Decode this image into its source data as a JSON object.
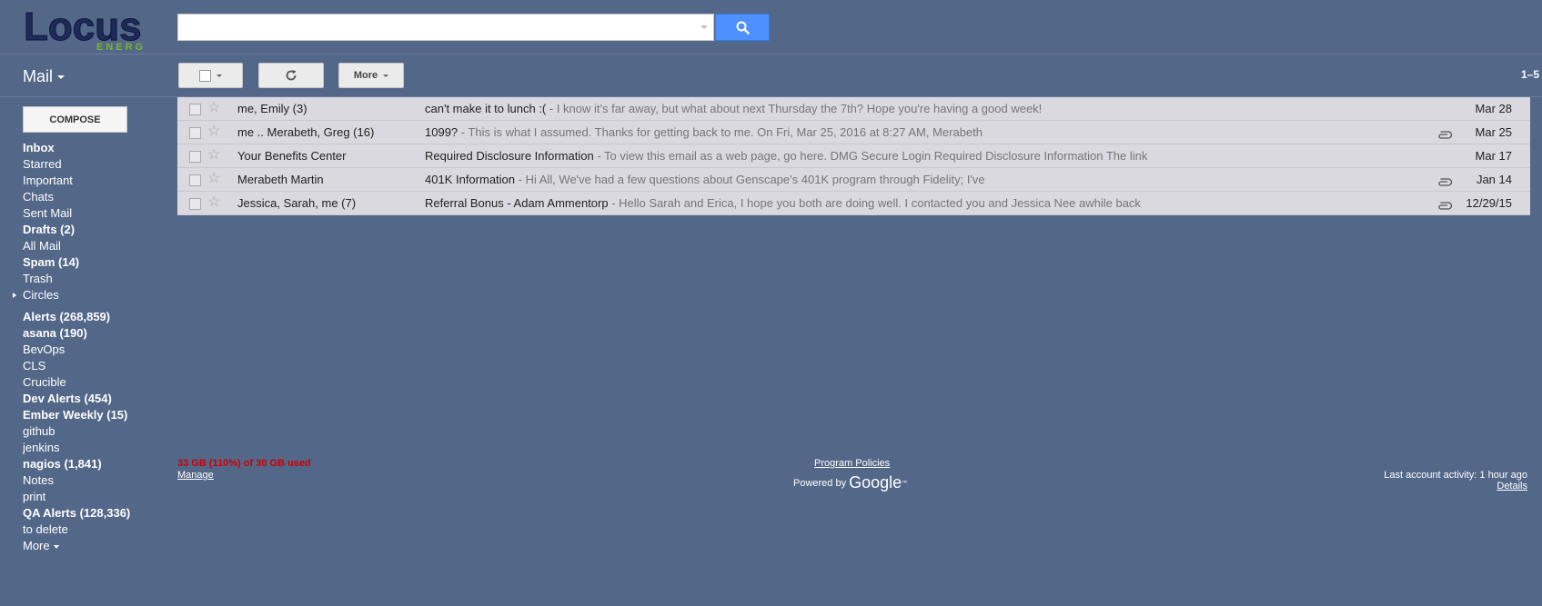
{
  "logo": {
    "word": "Locus",
    "sub": "ENERGY"
  },
  "search": {
    "placeholder": ""
  },
  "toolbar": {
    "more_label": "More",
    "range": "1–5"
  },
  "mail_title": "Mail",
  "compose_label": "COMPOSE",
  "sidebar": {
    "items": [
      {
        "label": "Inbox",
        "bold": true
      },
      {
        "label": "Starred",
        "bold": false
      },
      {
        "label": "Important",
        "bold": false
      },
      {
        "label": "Chats",
        "bold": false
      },
      {
        "label": "Sent Mail",
        "bold": false
      },
      {
        "label": "Drafts (2)",
        "bold": true
      },
      {
        "label": "All Mail",
        "bold": false
      },
      {
        "label": "Spam (14)",
        "bold": true
      },
      {
        "label": "Trash",
        "bold": false
      },
      {
        "label": "Circles",
        "bold": false
      }
    ],
    "labels": [
      {
        "label": "Alerts (268,859)",
        "bold": true
      },
      {
        "label": "asana (190)",
        "bold": true
      },
      {
        "label": "BevOps",
        "bold": false
      },
      {
        "label": "CLS",
        "bold": false
      },
      {
        "label": "Crucible",
        "bold": false
      },
      {
        "label": "Dev Alerts (454)",
        "bold": true
      },
      {
        "label": "Ember Weekly (15)",
        "bold": true
      },
      {
        "label": "github",
        "bold": false
      },
      {
        "label": "jenkins",
        "bold": false
      },
      {
        "label": "nagios (1,841)",
        "bold": true
      },
      {
        "label": "Notes",
        "bold": false
      },
      {
        "label": "print",
        "bold": false
      },
      {
        "label": "QA Alerts (128,336)",
        "bold": true
      },
      {
        "label": "to delete",
        "bold": false
      }
    ],
    "more_label": "More"
  },
  "emails": [
    {
      "from": "me, Emily (3)",
      "subject": "can't make it to lunch :(",
      "snippet": " - I know it's far away, but what about next Thursday the 7th? Hope you're having a good week!",
      "attachment": false,
      "date": "Mar 28"
    },
    {
      "from": "me .. Merabeth, Greg (16)",
      "subject": "1099?",
      "snippet": " - This is what I assumed. Thanks for getting back to me. On Fri, Mar 25, 2016 at 8:27 AM, Merabeth",
      "attachment": true,
      "date": "Mar 25"
    },
    {
      "from": "Your Benefits Center",
      "subject": "Required Disclosure Information",
      "snippet": " - To view this email as a web page, go here. DMG Secure Login Required Disclosure Information The link",
      "attachment": false,
      "date": "Mar 17"
    },
    {
      "from": "Merabeth Martin",
      "subject": "401K Information",
      "snippet": " - Hi All, We've had a few questions about Genscape's 401K program through Fidelity; I've",
      "attachment": true,
      "date": "Jan 14"
    },
    {
      "from": "Jessica, Sarah, me (7)",
      "subject": "Referral Bonus - Adam Ammentorp",
      "snippet": " - Hello Sarah and Erica, I hope you both are doing well. I contacted you and Jessica Nee awhile back",
      "attachment": true,
      "date": "12/29/15"
    }
  ],
  "footer": {
    "storage": "33 GB (110%) of 30 GB used",
    "manage": "Manage",
    "policies": "Program Policies",
    "powered_by": "Powered by",
    "google": "Google",
    "tm": "™",
    "activity": "Last account activity: 1 hour ago",
    "details": "Details"
  },
  "colors": {
    "background": "#536789",
    "row": "#d9d9df",
    "search_button": "#4d90fe",
    "storage_warning": "#cc0000",
    "logo_dark": "#1d2a5a",
    "logo_green": "#7ab32e"
  }
}
